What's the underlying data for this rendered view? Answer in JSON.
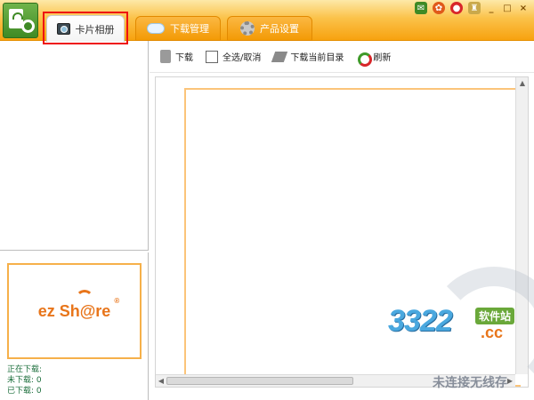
{
  "header": {
    "tabs": [
      {
        "label": "卡片相册",
        "icon": "album-icon",
        "active": true
      },
      {
        "label": "下载管理",
        "icon": "cloud-icon",
        "active": false
      },
      {
        "label": "产品设置",
        "icon": "gear-icon",
        "active": false
      }
    ],
    "window_controls": [
      "green-app-icon",
      "orange-icon",
      "weibo-icon",
      "trophy-icon",
      "minimize",
      "maximize",
      "close"
    ],
    "minimize_glyph": "_",
    "maximize_glyph": "□",
    "close_glyph": "×"
  },
  "toolbar": {
    "download": "下载",
    "select_all": "全选/取消",
    "download_dir": "下载当前目录",
    "refresh": "刷新"
  },
  "sidebar": {
    "brand": {
      "name": "ez Sh@re",
      "registered": "®"
    },
    "status": {
      "downloading": "正在下载:",
      "not_downloaded": "未下载: 0",
      "downloaded": "已下载: 0"
    }
  },
  "watermark": {
    "number": "3322",
    "domain": ".cc",
    "site": "软件站",
    "status": "未连接无线存"
  },
  "colors": {
    "accent": "#f7a20f",
    "frame": "#fbc47a",
    "brand": "#e8751a",
    "highlight": "#e11111"
  }
}
